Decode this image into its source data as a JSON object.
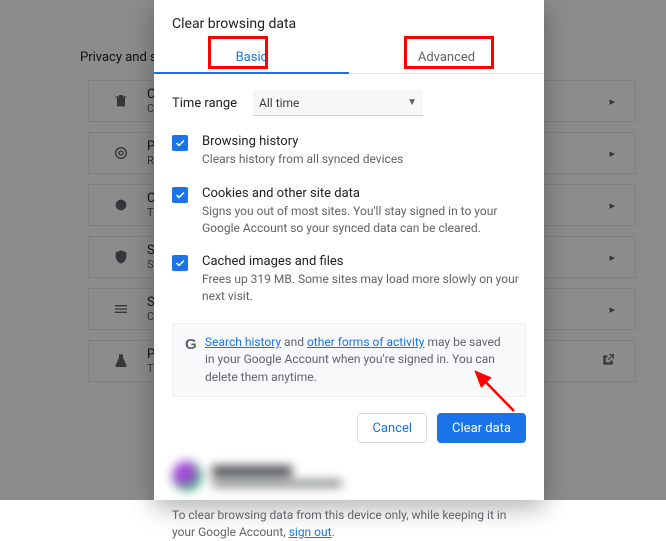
{
  "background": {
    "section_title": "Privacy and s",
    "items": [
      {
        "icon": "trash",
        "title": "Clear",
        "sub": "Clea"
      },
      {
        "icon": "target",
        "title": "Priva",
        "sub": "Revi"
      },
      {
        "icon": "cookie",
        "title": "Cook",
        "sub": "Third"
      },
      {
        "icon": "shield",
        "title": "Secu",
        "sub": "Safe"
      },
      {
        "icon": "sliders",
        "title": "Site",
        "sub": "Cont"
      },
      {
        "icon": "flask",
        "title": "Priva",
        "sub": "Trial"
      }
    ]
  },
  "dialog": {
    "title": "Clear browsing data",
    "tabs": {
      "basic": "Basic",
      "advanced": "Advanced"
    },
    "time_range": {
      "label": "Time range",
      "value": "All time"
    },
    "options": {
      "history": {
        "title": "Browsing history",
        "desc": "Clears history from all synced devices"
      },
      "cookies": {
        "title": "Cookies and other site data",
        "desc": "Signs you out of most sites. You'll stay signed in to your Google Account so your synced data can be cleared."
      },
      "cache": {
        "title": "Cached images and files",
        "desc": "Frees up 319 MB. Some sites may load more slowly on your next visit."
      }
    },
    "info": {
      "link1": "Search history",
      "mid1": " and ",
      "link2": "other forms of activity",
      "rest": " may be saved in your Google Account when you're signed in. You can delete them anytime."
    },
    "buttons": {
      "cancel": "Cancel",
      "clear": "Clear data"
    },
    "bottom_note": {
      "text": "To clear browsing data from this device only, while keeping it in your Google Account, ",
      "link": "sign out",
      "tail": "."
    }
  }
}
